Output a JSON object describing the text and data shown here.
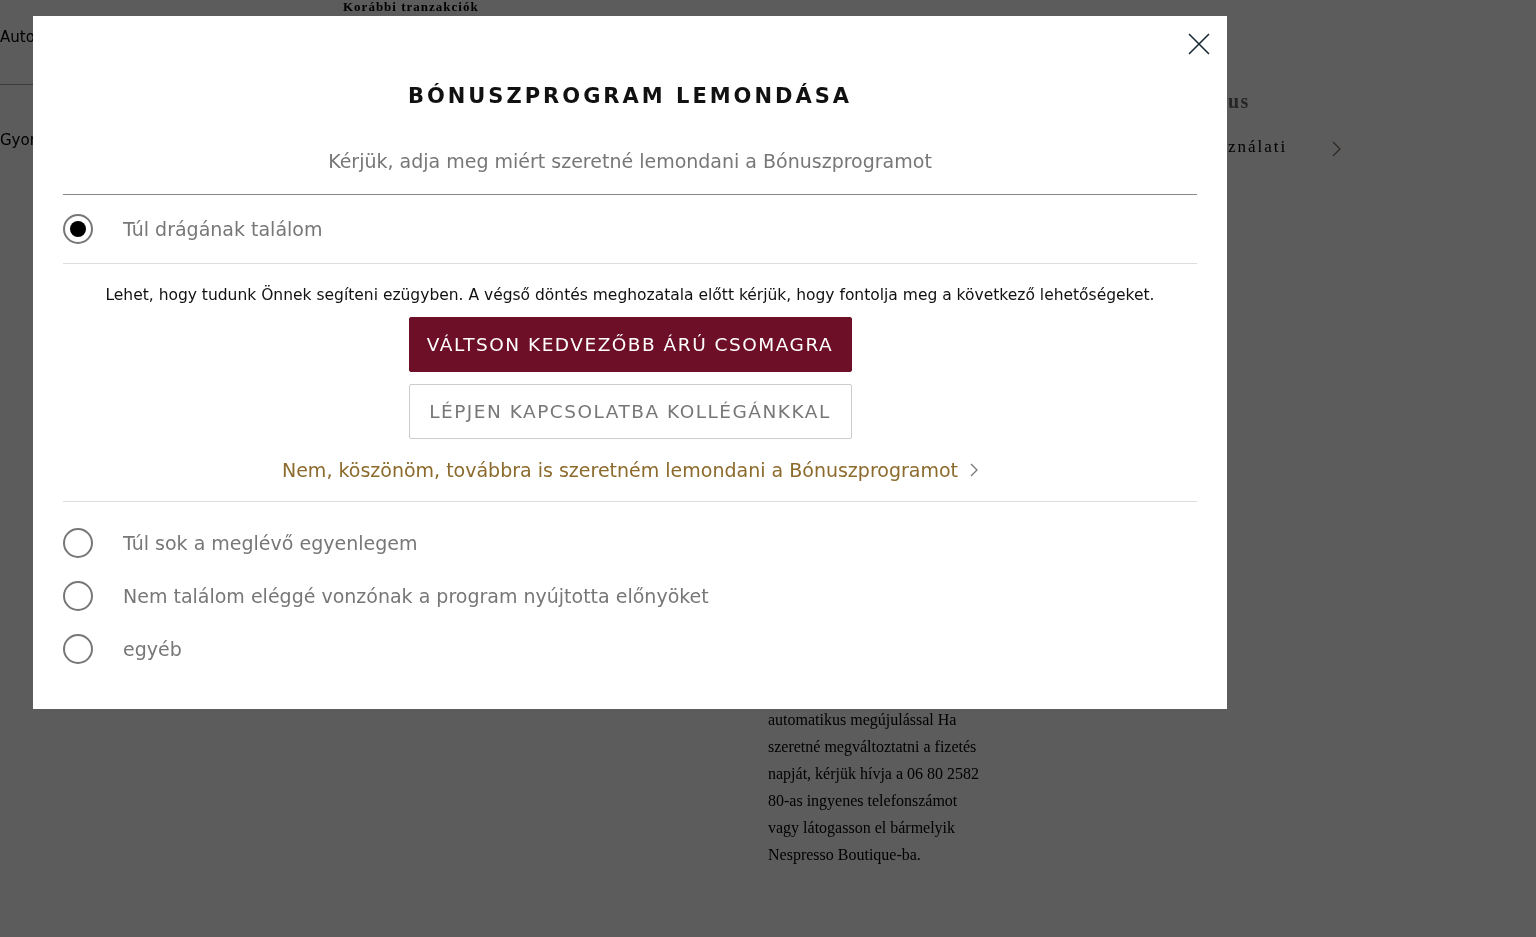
{
  "background_page": {
    "heading": "Korábbi tranzakciók",
    "left_items": [
      "Auto",
      "Gyor"
    ],
    "right_heading": "us",
    "right_item": "ználati",
    "note": "automatikus megújulással Ha szeretné megváltoztatni a fizetés napját, kérjük hívja a 06 80 2582 80-as ingyenes telefonszámot vagy látogasson el bármelyik Nespresso Boutique-ba."
  },
  "dialog": {
    "title": "BÓNUSZPROGRAM LEMONDÁSA",
    "subtitle": "Kérjük, adja meg miért szeretné lemondani a Bónuszprogramot",
    "options": [
      {
        "label": "Túl drágának találom",
        "selected": true
      },
      {
        "label": "Túl sok a meglévő egyenlegem",
        "selected": false
      },
      {
        "label": "Nem találom eléggé vonzónak a program nyújtotta előnyöket",
        "selected": false
      },
      {
        "label": "egyéb",
        "selected": false
      }
    ],
    "retention": {
      "message": "Lehet, hogy tudunk Önnek segíteni ezügyben. A végső döntés meghozatala előtt kérjük, hogy fontolja meg a következő lehetőségeket.",
      "buttons": [
        {
          "label": "VÁLTSON KEDVEZŐBB ÁRÚ CSOMAGRA",
          "kind": "primary"
        },
        {
          "label": "LÉPJEN KAPCSOLATBA KOLLÉGÁNKKAL",
          "kind": "secondary"
        }
      ],
      "decline_link": "Nem, köszönöm, továbbra is szeretném lemondani a Bónuszprogramot"
    }
  }
}
